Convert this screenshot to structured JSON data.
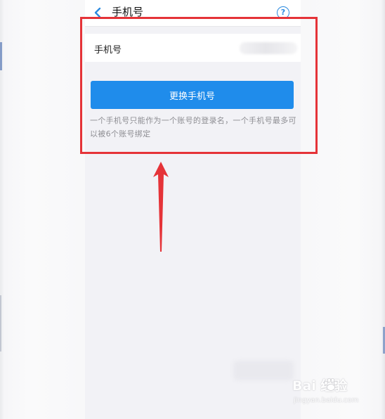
{
  "navbar": {
    "title": "手机号",
    "back_icon": "chevron-left-icon",
    "help_icon": "question-circle-icon",
    "help_glyph": "?"
  },
  "phone_row": {
    "label": "手机号"
  },
  "change_button": {
    "label": "更换手机号"
  },
  "hint": {
    "text": "一个手机号只能作为一个账号的登录名，一个手机号最多可以被6个账号绑定"
  },
  "annotation": {
    "highlight_color": "#e53338"
  },
  "watermark": {
    "main": "Bai  经验",
    "sub": "jingyan.baidu.com"
  },
  "colors": {
    "accent": "#1f8ceb",
    "background": "#f2f2f6"
  }
}
